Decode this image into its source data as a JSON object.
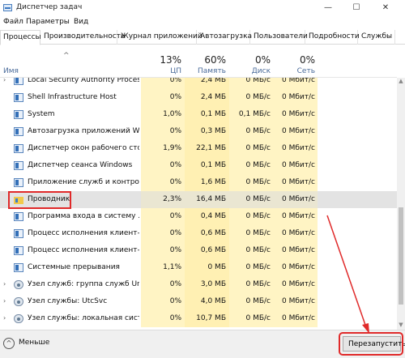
{
  "window": {
    "title": "Диспетчер задач",
    "minimize": "—",
    "maximize": "☐",
    "close": "✕"
  },
  "menu": [
    "Файл",
    "Параметры",
    "Вид"
  ],
  "tabs": [
    "Процессы",
    "Производительность",
    "Журнал приложений",
    "Автозагрузка",
    "Пользователи",
    "Подробности",
    "Службы"
  ],
  "header": {
    "sort_glyph": "^",
    "name": "Имя",
    "cpu_pct": "13%",
    "cpu_label": "ЦП",
    "mem_pct": "60%",
    "mem_label": "Память",
    "disk_pct": "0%",
    "disk_label": "Диск",
    "net_pct": "0%",
    "net_label": "Сеть"
  },
  "processes": [
    {
      "name": "Local Security Authority Proces...",
      "cpu": "0%",
      "mem": "2,4 МБ",
      "disk": "0 МБ/с",
      "net": "0 Мбит/с",
      "expandable": true,
      "icon": "window-icon"
    },
    {
      "name": "Shell Infrastructure Host",
      "cpu": "0%",
      "mem": "2,4 МБ",
      "disk": "0 МБ/с",
      "net": "0 Мбит/с",
      "expandable": false,
      "icon": "window-icon"
    },
    {
      "name": "System",
      "cpu": "1,0%",
      "mem": "0,1 МБ",
      "disk": "0,1 МБ/с",
      "net": "0 Мбит/с",
      "expandable": false,
      "icon": "window-icon"
    },
    {
      "name": "Автозагрузка приложений Wi...",
      "cpu": "0%",
      "mem": "0,3 МБ",
      "disk": "0 МБ/с",
      "net": "0 Мбит/с",
      "expandable": false,
      "icon": "window-icon"
    },
    {
      "name": "Диспетчер окон рабочего сто...",
      "cpu": "1,9%",
      "mem": "22,1 МБ",
      "disk": "0 МБ/с",
      "net": "0 Мбит/с",
      "expandable": false,
      "icon": "window-icon"
    },
    {
      "name": "Диспетчер сеанса  Windows",
      "cpu": "0%",
      "mem": "0,1 МБ",
      "disk": "0 МБ/с",
      "net": "0 Мбит/с",
      "expandable": false,
      "icon": "window-icon"
    },
    {
      "name": "Приложение служб и контро...",
      "cpu": "0%",
      "mem": "1,6 МБ",
      "disk": "0 МБ/с",
      "net": "0 Мбит/с",
      "expandable": false,
      "icon": "window-icon"
    },
    {
      "name": "Проводник",
      "cpu": "2,3%",
      "mem": "16,4 МБ",
      "disk": "0 МБ/с",
      "net": "0 Мбит/с",
      "expandable": false,
      "icon": "explorer-icon",
      "selected": true
    },
    {
      "name": "Программа входа в систему ...",
      "cpu": "0%",
      "mem": "0,4 МБ",
      "disk": "0 МБ/с",
      "net": "0 Мбит/с",
      "expandable": false,
      "icon": "window-icon"
    },
    {
      "name": "Процесс исполнения клиент-...",
      "cpu": "0%",
      "mem": "0,6 МБ",
      "disk": "0 МБ/с",
      "net": "0 Мбит/с",
      "expandable": false,
      "icon": "window-icon"
    },
    {
      "name": "Процесс исполнения клиент-...",
      "cpu": "0%",
      "mem": "0,6 МБ",
      "disk": "0 МБ/с",
      "net": "0 Мбит/с",
      "expandable": false,
      "icon": "window-icon"
    },
    {
      "name": "Системные прерывания",
      "cpu": "1,1%",
      "mem": "0 МБ",
      "disk": "0 МБ/с",
      "net": "0 Мбит/с",
      "expandable": false,
      "icon": "window-icon"
    },
    {
      "name": "Узел служб: группа служб Uni...",
      "cpu": "0%",
      "mem": "3,0 МБ",
      "disk": "0 МБ/с",
      "net": "0 Мбит/с",
      "expandable": true,
      "icon": "gear-icon"
    },
    {
      "name": "Узел службы: UtcSvc",
      "cpu": "0%",
      "mem": "4,0 МБ",
      "disk": "0 МБ/с",
      "net": "0 Мбит/с",
      "expandable": true,
      "icon": "gear-icon"
    },
    {
      "name": "Узел службы: локальная сист...",
      "cpu": "0%",
      "mem": "10,7 МБ",
      "disk": "0 МБ/с",
      "net": "0 Мбит/с",
      "expandable": true,
      "icon": "gear-icon"
    }
  ],
  "footer": {
    "less_glyph": "^",
    "less_label": "Меньше",
    "restart_label": "Перезапустить"
  },
  "colors": {
    "highlight": "#e02a2a",
    "cpu_bg": "#fff4c4",
    "mem_bg": "#fff0b3"
  }
}
